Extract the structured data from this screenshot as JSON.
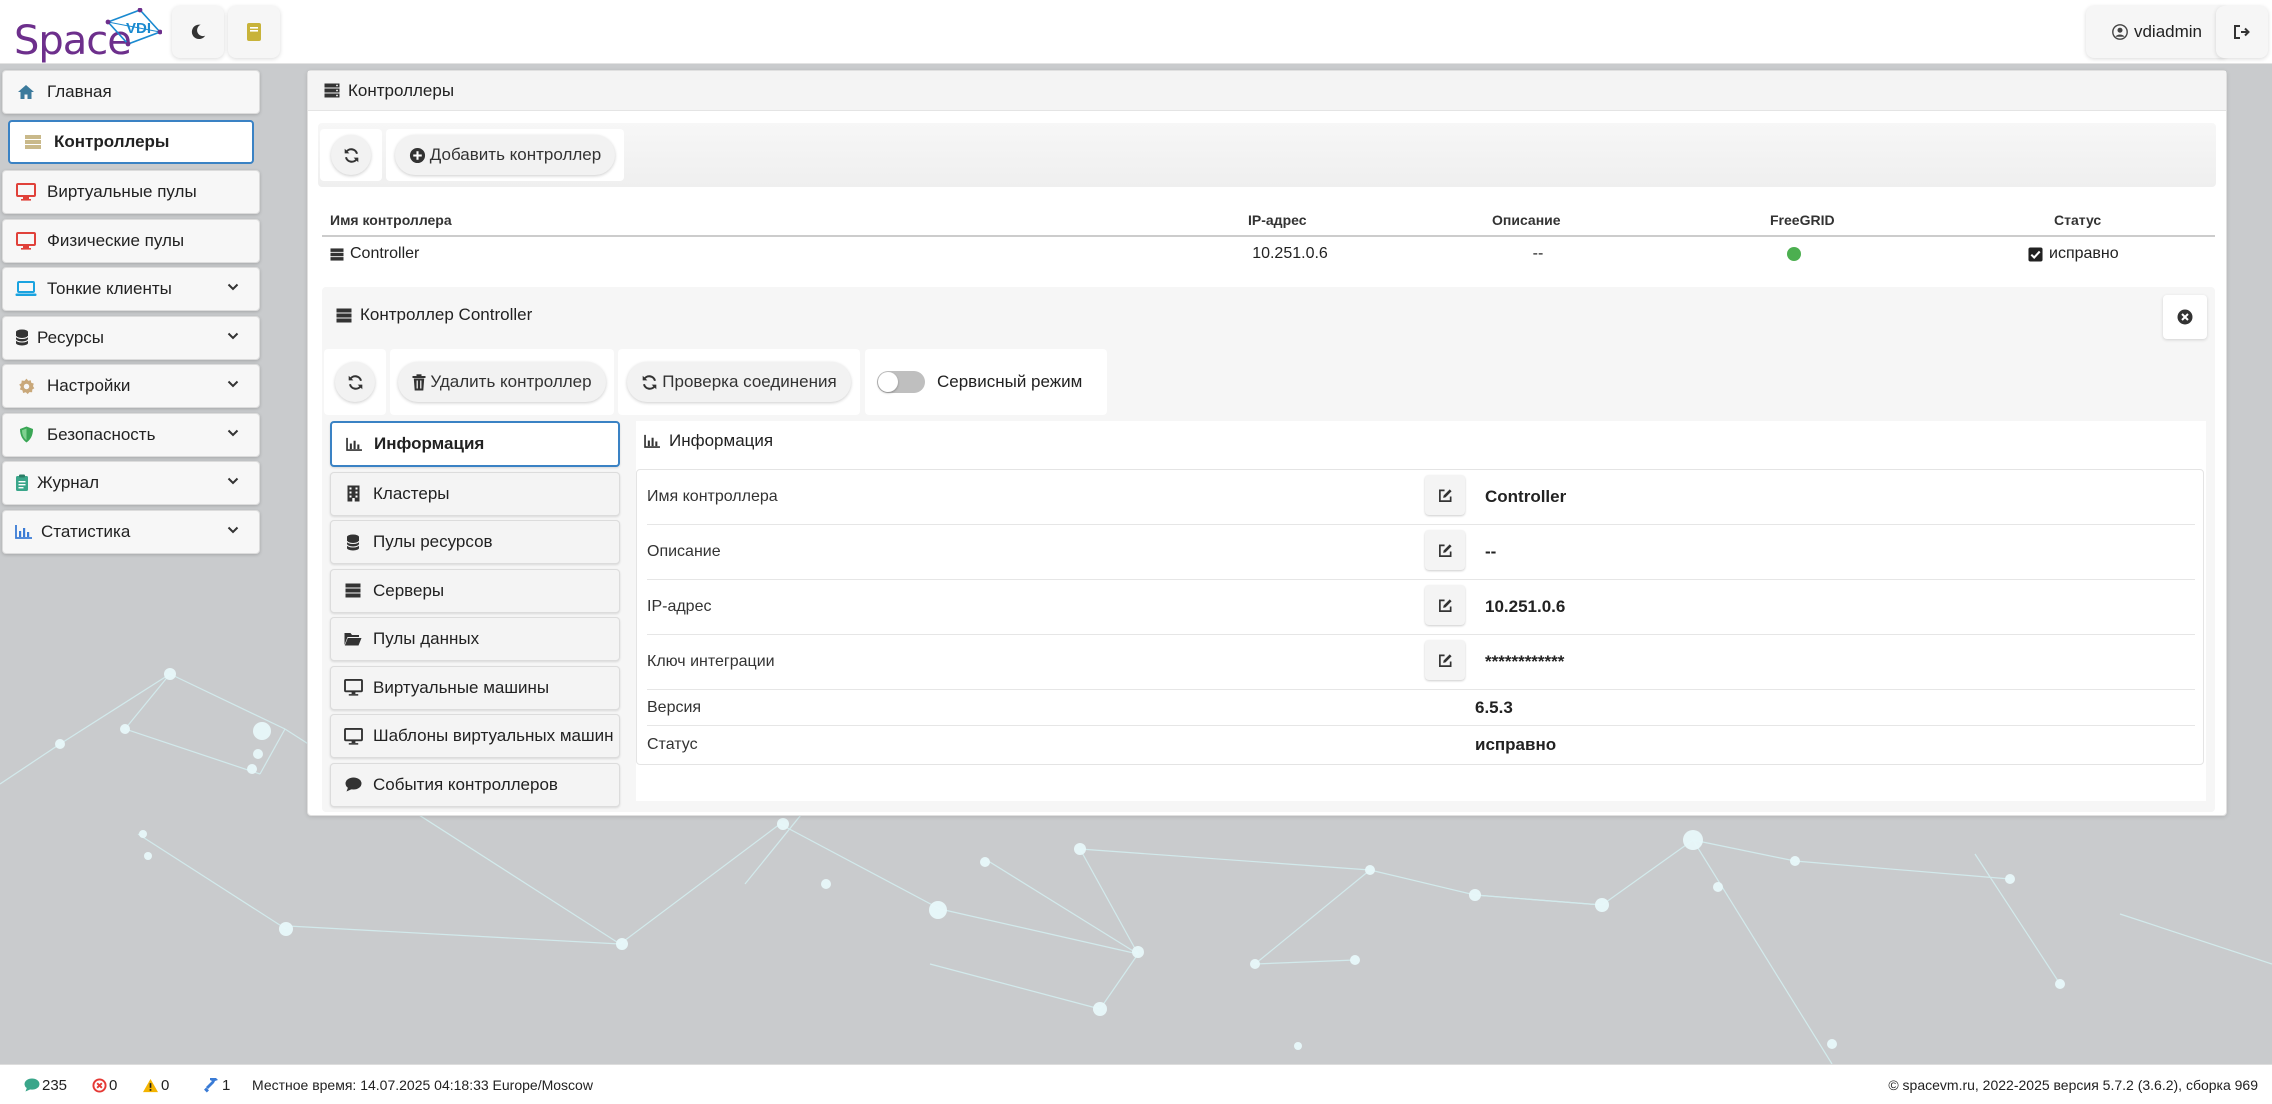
{
  "app": {
    "logo_text": "Space",
    "logo_badge": "VDI",
    "user_name": "vdiadmin"
  },
  "sidebar": {
    "items": [
      {
        "label": "Главная",
        "icon": "home-icon"
      },
      {
        "label": "Контроллеры",
        "icon": "server-icon",
        "active": true
      },
      {
        "label": "Виртуальные пулы",
        "icon": "monitor-icon"
      },
      {
        "label": "Физические пулы",
        "icon": "monitor-icon"
      },
      {
        "label": "Тонкие клиенты",
        "icon": "laptop-icon"
      },
      {
        "label": "Ресурсы",
        "icon": "database-icon"
      },
      {
        "label": "Настройки",
        "icon": "gear-icon"
      },
      {
        "label": "Безопасность",
        "icon": "shield-icon"
      },
      {
        "label": "Журнал",
        "icon": "clipboard-icon"
      },
      {
        "label": "Статистика",
        "icon": "chart-icon"
      }
    ]
  },
  "main": {
    "title": "Контроллеры",
    "add_button": "Добавить контроллер"
  },
  "table": {
    "headers": [
      "Имя контроллера",
      "IP-адрес",
      "Описание",
      "FreeGRID",
      "Статус"
    ],
    "rows": [
      {
        "name": "Controller",
        "ip": "10.251.0.6",
        "description": "--",
        "status": "исправно"
      }
    ]
  },
  "detail": {
    "title": "Контроллер Controller",
    "delete_button": "Удалить контроллер",
    "check_button": "Проверка соединения",
    "service_mode": "Сервисный режим",
    "tabs": [
      {
        "label": "Информация",
        "icon": "chart-icon",
        "active": true
      },
      {
        "label": "Кластеры",
        "icon": "building-icon"
      },
      {
        "label": "Пулы ресурсов",
        "icon": "database-icon"
      },
      {
        "label": "Серверы",
        "icon": "server-icon"
      },
      {
        "label": "Пулы данных",
        "icon": "folder-icon"
      },
      {
        "label": "Виртуальные машины",
        "icon": "desktop-icon"
      },
      {
        "label": "Шаблоны виртуальных машин",
        "icon": "desktop-icon"
      },
      {
        "label": "События контроллеров",
        "icon": "comment-icon"
      }
    ],
    "info_title": "Информация",
    "info": [
      {
        "label": "Имя контроллера",
        "value": "Controller",
        "editable": true
      },
      {
        "label": "Описание",
        "value": "--",
        "editable": true
      },
      {
        "label": "IP-адрес",
        "value": "10.251.0.6",
        "editable": true
      },
      {
        "label": "Ключ интеграции",
        "value": "************",
        "editable": true
      },
      {
        "label": "Версия",
        "value": "6.5.3",
        "editable": false
      },
      {
        "label": "Статус",
        "value": "исправно",
        "editable": false
      }
    ]
  },
  "footer": {
    "messages": "235",
    "errors": "0",
    "warnings": "0",
    "tasks": "1",
    "local_time": "Местное время: 14.07.2025 04:18:33 Europe/Moscow",
    "copyright": "© spacevm.ru, 2022-2025 версия 5.7.2 (3.6.2), сборка 969"
  },
  "colors": {
    "accent": "#3a82c4",
    "brand": "#6d2f8c",
    "ok_green": "#4caf50",
    "error_red": "#e53935",
    "warning_yellow": "#f4b400"
  }
}
